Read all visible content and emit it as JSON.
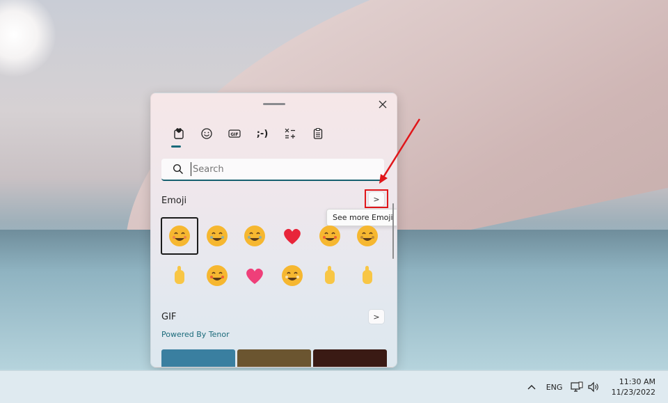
{
  "panel": {
    "tabs": [
      {
        "name": "favorites",
        "label": ""
      },
      {
        "name": "emoji",
        "label": ""
      },
      {
        "name": "gif",
        "label": "GIF"
      },
      {
        "name": "kaomoji",
        "label": ";-)"
      },
      {
        "name": "symbols",
        "label": ""
      },
      {
        "name": "clipboard",
        "label": ""
      }
    ],
    "search": {
      "placeholder": "Search"
    },
    "emoji_section": {
      "title": "Emoji",
      "more_label": ">",
      "tooltip": "See more Emoji"
    },
    "emojis": [
      {
        "name": "smiling-face-with-smiling-eyes",
        "colors": [
          "#f6b730",
          "#e85d5d"
        ]
      },
      {
        "name": "face-with-tears-of-joy",
        "colors": [
          "#f6b730",
          "#53a7e6"
        ]
      },
      {
        "name": "rolling-on-floor-laughing",
        "colors": [
          "#f6b730",
          "#53a7e6"
        ]
      },
      {
        "name": "red-heart",
        "colors": [
          "#e8253a",
          "#e8253a"
        ]
      },
      {
        "name": "smiling-face-with-heart-eyes",
        "colors": [
          "#f6b730",
          "#e8253a"
        ]
      },
      {
        "name": "pleading-face",
        "colors": [
          "#f6b730",
          "#9a6b3a"
        ]
      },
      {
        "name": "ok-hand",
        "colors": [
          "#f8c645",
          "#f8c645"
        ]
      },
      {
        "name": "face-blowing-a-kiss",
        "colors": [
          "#f6b730",
          "#e8253a"
        ]
      },
      {
        "name": "two-hearts",
        "colors": [
          "#ef3f79",
          "#ef3f79"
        ]
      },
      {
        "name": "beaming-face",
        "colors": [
          "#f6b730",
          "#ffffff"
        ]
      },
      {
        "name": "thumbs-up",
        "colors": [
          "#f8c645",
          "#f8c645"
        ]
      },
      {
        "name": "raising-hands",
        "colors": [
          "#f8c645",
          "#53a7e6"
        ]
      }
    ],
    "gif_section": {
      "title": "GIF",
      "more_label": ">",
      "powered_by": "Powered By Tenor"
    },
    "gif_thumbs": [
      "#3a7fa0",
      "#6b5530",
      "#3a1a14"
    ]
  },
  "taskbar": {
    "chevron": "^",
    "language": "ENG",
    "time": "11:30 AM",
    "date": "11/23/2022"
  },
  "colors": {
    "accent": "#16606f",
    "highlight": "#e0161a"
  }
}
